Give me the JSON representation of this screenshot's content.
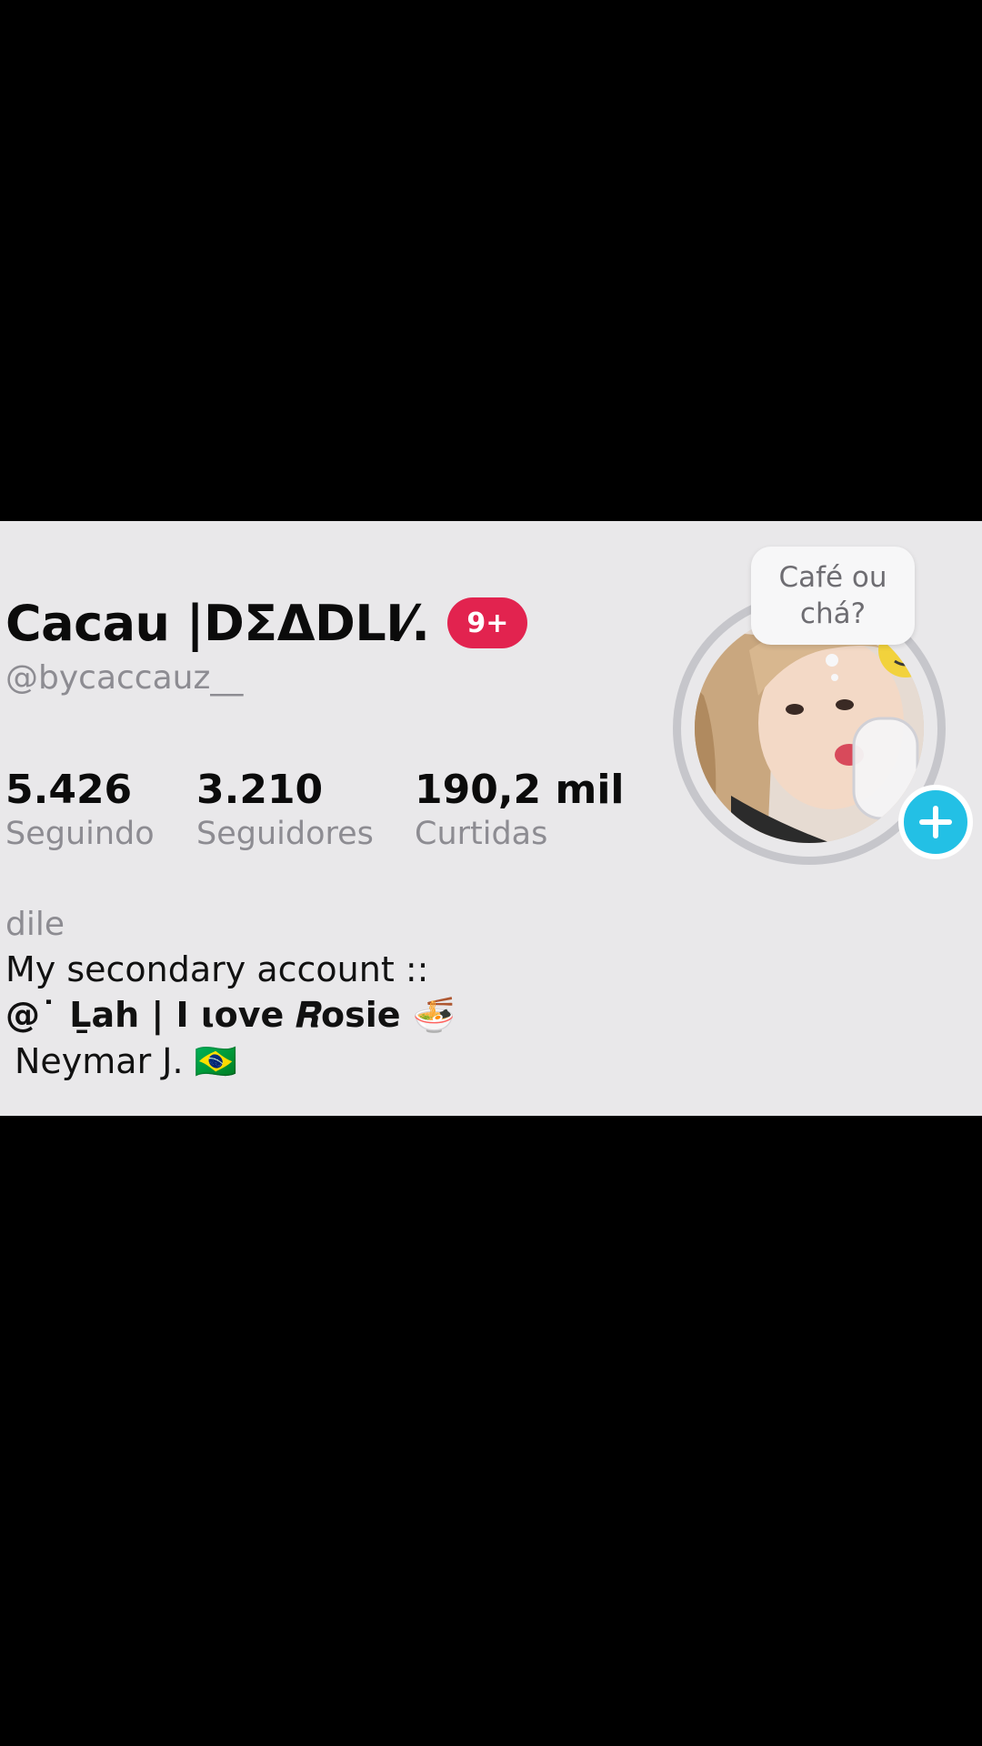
{
  "profile": {
    "display_name": "Cacau |DΣΔDLI⁄.",
    "notification_badge": "9+",
    "username": "@bycaccauz__",
    "note": "Café ou chá?",
    "add_icon": "plus-icon"
  },
  "stats": [
    {
      "value": "5.426",
      "label": "Seguindo"
    },
    {
      "value": "3.210",
      "label": "Seguidores"
    },
    {
      "value": "190,2 mil",
      "label": "Curtidas"
    }
  ],
  "bio": {
    "line1": "dile",
    "line2": "My secondary account ::",
    "line3": "@˙ Ḻah | I ιove 𝑹osie 🍜",
    "line4": "Neymar J. 🇧🇷"
  },
  "colors": {
    "background": "#000000",
    "card": "#e9e8ea",
    "badge": "#e2234f",
    "add_button": "#23c0e5",
    "muted_text": "#8d8c92"
  }
}
